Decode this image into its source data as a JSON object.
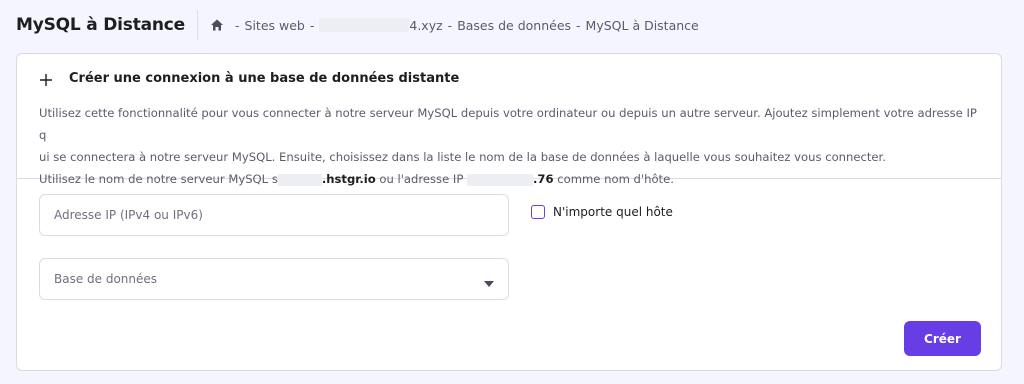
{
  "header": {
    "title": "MySQL à Distance",
    "breadcrumb": {
      "home_icon": "home-icon",
      "separator": "-",
      "sites": "Sites web",
      "domain_suffix": "4.xyz",
      "databases": "Bases de données",
      "current": "MySQL à Distance"
    }
  },
  "card": {
    "title": "Créer une connexion à une base de données distante",
    "plus_icon": "plus-icon",
    "desc_line1": "Utilisez cette fonctionnalité pour vous connecter à notre serveur MySQL depuis votre ordinateur ou depuis un autre serveur. Ajoutez simplement votre adresse IP q",
    "desc_line2": "ui se connectera à notre serveur MySQL. Ensuite, choisissez dans la liste le nom de la base de données à laquelle vous souhaitez vous connecter.",
    "desc_line3_prefix": "Utilisez le nom de notre serveur MySQL s",
    "host_suffix": ".hstgr.io",
    "desc_line3_mid": "ou l'adresse IP",
    "ip_suffix": ".76",
    "desc_line3_end": "comme nom d'hôte."
  },
  "form": {
    "ip_placeholder": "Adresse IP (IPv4 ou IPv6)",
    "any_host_label": "N'importe quel hôte",
    "any_host_checked": false,
    "database_placeholder": "Base de données",
    "create_label": "Créer"
  },
  "colors": {
    "accent": "#673de6",
    "background": "#f4f5ff",
    "border": "#dadce0"
  }
}
